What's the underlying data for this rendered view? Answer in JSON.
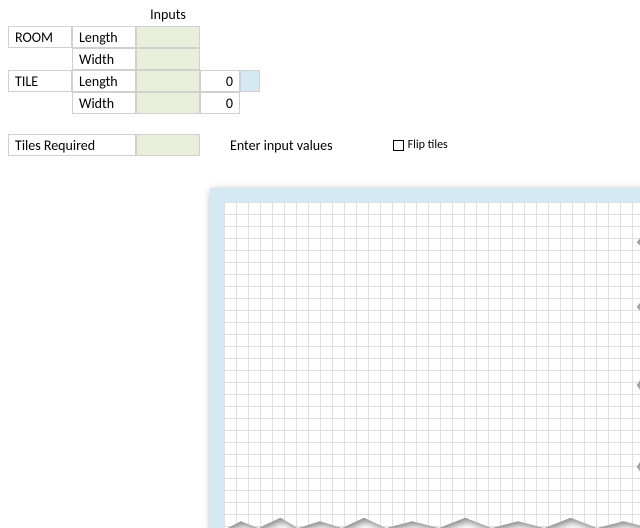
{
  "inputs": {
    "header": "Inputs",
    "room": {
      "label": "ROOM",
      "length_label": "Length",
      "width_label": "Width",
      "length_value": "",
      "width_value": ""
    },
    "tile": {
      "label": "TILE",
      "length_label": "Length",
      "width_label": "Width",
      "length_value": "",
      "width_value": "",
      "length_result": "0",
      "width_result": "0"
    }
  },
  "required": {
    "label": "Tiles Required",
    "result": "",
    "message": "Enter input values"
  },
  "flip": {
    "label": "Flip tiles",
    "checked": false
  }
}
